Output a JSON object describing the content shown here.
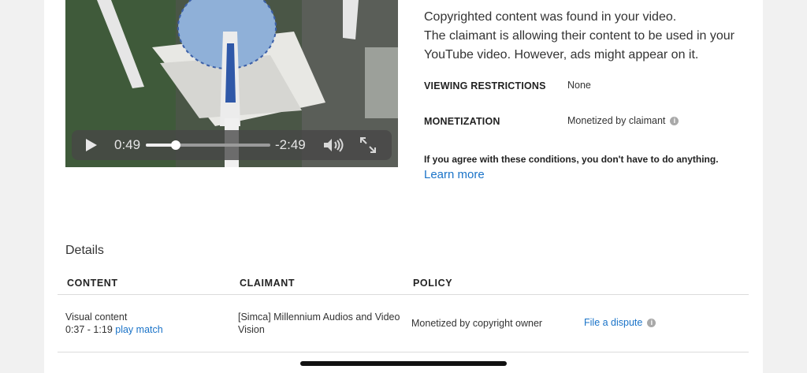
{
  "player": {
    "elapsed": "0:49",
    "remaining": "-2:49",
    "progress": 0.24
  },
  "conditions": {
    "line1": "Copyrighted content was found in your video.",
    "line2": "The claimant is allowing their content to be used in your",
    "line3": "YouTube video. However, ads might appear on it.",
    "viewing_label": "VIEWING RESTRICTIONS",
    "viewing_value": "None",
    "monetization_label": "MONETIZATION",
    "monetization_value": "Monetized by claimant",
    "agree_note": "If you agree with these conditions, you don't have to do anything.",
    "learn_more": "Learn more"
  },
  "details": {
    "title": "Details",
    "headers": {
      "content": "CONTENT",
      "claimant": "CLAIMANT",
      "policy": "POLICY"
    },
    "row": {
      "content_type": "Visual content",
      "range": "0:37 - 1:19",
      "play_match": "play match",
      "claimant_line1": "[Simca] Millennium Audios and Video",
      "claimant_line2": "Vision",
      "policy": "Monetized by copyright owner",
      "dispute": "File a dispute"
    }
  },
  "icons": {
    "play": "play-icon",
    "volume": "volume-icon",
    "fullscreen": "fullscreen-icon",
    "info": "info-icon"
  },
  "colors": {
    "link": "#1a73c8"
  }
}
